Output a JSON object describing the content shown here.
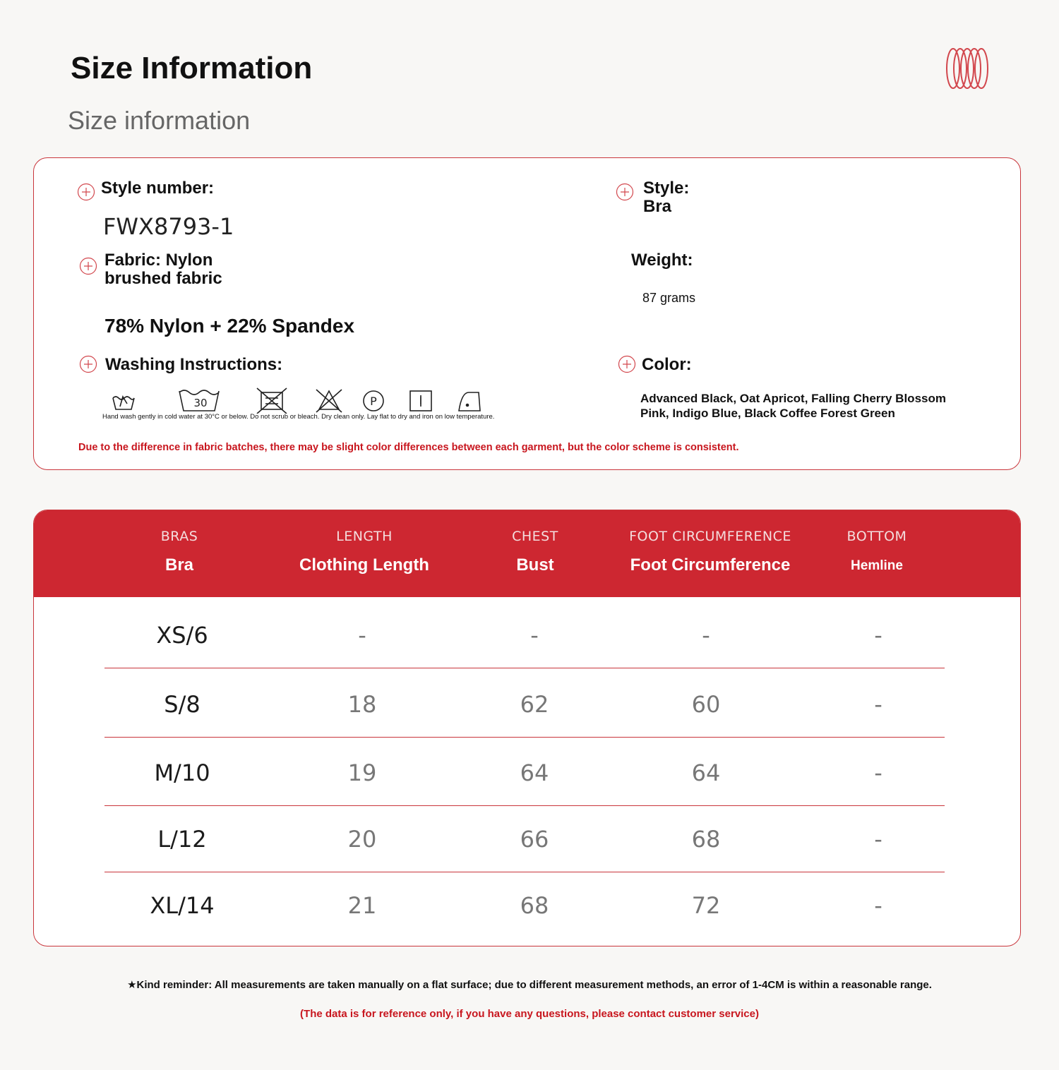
{
  "header": {
    "title": "Size Information",
    "subtitle": "Size information"
  },
  "info": {
    "style_number_label": "Style number:",
    "style_number_value": "FWX8793-1",
    "style_label": "Style:",
    "style_value": "Bra",
    "fabric_label_line1": "Fabric: Nylon",
    "fabric_label_line2": "brushed fabric",
    "fabric_composition": "78% Nylon + 22% Spandex",
    "weight_label": "Weight:",
    "weight_value": "87 grams",
    "washing_label": "Washing Instructions:",
    "wash_icon_30": "30",
    "wash_icon_p": "P",
    "wash_icon_i": "I",
    "washing_note": "Hand wash gently in cold water at 30°C or below. Do not scrub or bleach. Dry clean only. Lay flat to dry and iron on low temperature.",
    "color_label": "Color:",
    "color_line1": "Advanced Black, Oat Apricot, Falling Cherry Blossom",
    "color_line2": "Pink, Indigo Blue, Black Coffee Forest Green",
    "disclaimer": "Due to the difference in fabric batches, there may be slight color differences between each garment, but the color scheme is consistent."
  },
  "table": {
    "columns": [
      {
        "en": "BRAS",
        "sub": "Bra"
      },
      {
        "en": "LENGTH",
        "sub": "Clothing Length"
      },
      {
        "en": "CHEST",
        "sub": "Bust"
      },
      {
        "en": "FOOT CIRCUMFERENCE",
        "sub": "Foot Circumference"
      },
      {
        "en": "BOTTOM",
        "sub": "Hemline"
      }
    ],
    "rows": [
      [
        "XS/6",
        "-",
        "-",
        "-",
        "-"
      ],
      [
        "S/8",
        "18",
        "62",
        "60",
        "-"
      ],
      [
        "M/10",
        "19",
        "64",
        "64",
        "-"
      ],
      [
        "L/12",
        "20",
        "66",
        "68",
        "-"
      ],
      [
        "XL/14",
        "21",
        "68",
        "72",
        "-"
      ]
    ]
  },
  "footer": {
    "reminder": "★Kind reminder: All measurements are taken manually on a flat surface; due to different measurement methods, an error of 1-4CM is within a reasonable range.",
    "contact": "(The data is for reference only, if you have any questions, please contact customer service)"
  },
  "colors": {
    "accent": "#cd2731",
    "border": "#c9353b",
    "warning_text": "#c8161e"
  }
}
